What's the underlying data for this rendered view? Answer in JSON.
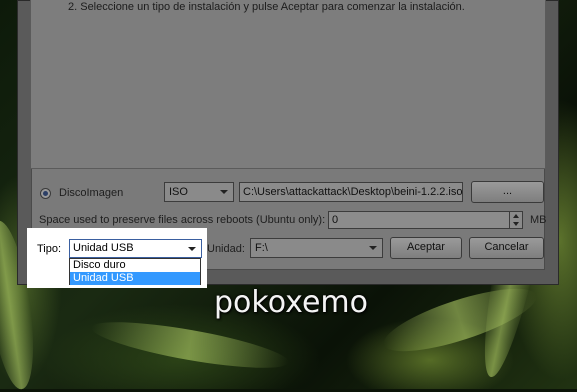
{
  "dialog": {
    "instruction": "2. Seleccione un tipo de instalación y pulse Aceptar para comenzar la instalación.",
    "source": {
      "radio_label": "DiscoImagen",
      "format_value": "ISO",
      "path_value": "C:\\Users\\attackattack\\Desktop\\beini-1.2.2.iso",
      "browse_label": "..."
    },
    "persistence": {
      "label": "Space used to preserve files across reboots (Ubuntu only):",
      "value": "0",
      "unit": "MB"
    },
    "tipo": {
      "label": "Tipo:",
      "value": "Unidad USB",
      "options": [
        "Disco duro",
        "Unidad USB"
      ],
      "selected_index": 1
    },
    "unidad": {
      "label": "Unidad:",
      "value": "F:\\"
    },
    "accept_label": "Aceptar",
    "cancel_label": "Cancelar"
  },
  "watermark": "pokoxemo"
}
